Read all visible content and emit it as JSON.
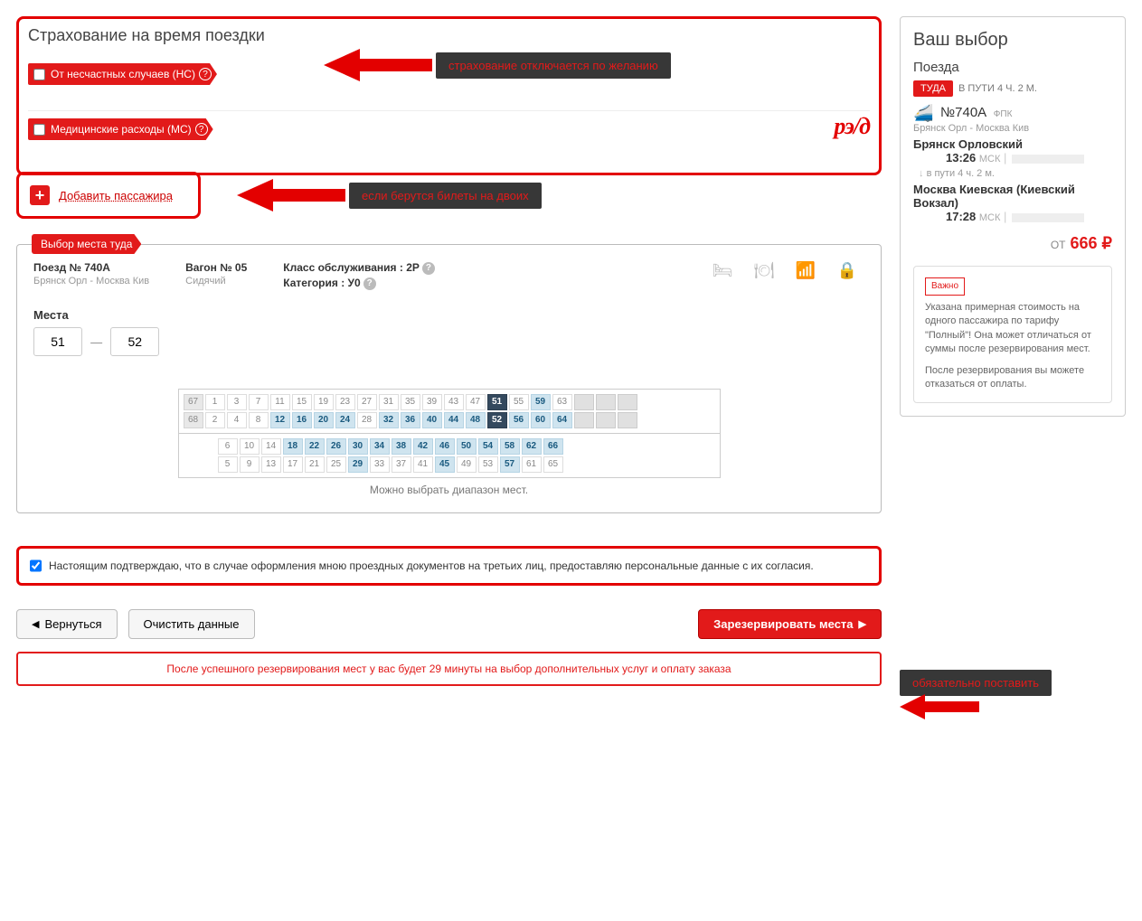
{
  "insurance": {
    "title": "Страхование на время поездки",
    "opt1": "От несчастных случаев (НС)",
    "opt2": "Медицинские расходы (МС)"
  },
  "annot": {
    "a1": "страхование отключается по желанию",
    "a2": "если берутся билеты на двоих",
    "a3": "обязательно поставить"
  },
  "addPassenger": "Добавить пассажира",
  "seatTab": "Выбор места туда",
  "trainCol": {
    "hdr": "Поезд № 740А",
    "sub": "Брянск Орл - Москва Кив"
  },
  "carCol": {
    "hdr": "Вагон № 05",
    "sub": "Сидячий"
  },
  "clsCol": {
    "l1": "Класс обслуживания : 2Р",
    "l2": "Категория : У0"
  },
  "seats": {
    "label": "Места",
    "from": "51",
    "to": "52",
    "note": "Можно выбрать диапазон мест.",
    "topRow1": [
      {
        "n": "67",
        "c": "left"
      },
      {
        "n": "1"
      },
      {
        "n": "3"
      },
      {
        "n": "7"
      },
      {
        "n": "11"
      },
      {
        "n": "15"
      },
      {
        "n": "19"
      },
      {
        "n": "23"
      },
      {
        "n": "27"
      },
      {
        "n": "31"
      },
      {
        "n": "35"
      },
      {
        "n": "39"
      },
      {
        "n": "43"
      },
      {
        "n": "47"
      },
      {
        "n": "51",
        "c": "sel"
      },
      {
        "n": "55"
      },
      {
        "n": "59",
        "c": "avail"
      },
      {
        "n": "63"
      },
      {
        "n": "",
        "c": "blank"
      },
      {
        "n": "",
        "c": "blank"
      },
      {
        "n": "",
        "c": "blank"
      }
    ],
    "topRow2": [
      {
        "n": "68",
        "c": "left"
      },
      {
        "n": "2"
      },
      {
        "n": "4"
      },
      {
        "n": "8"
      },
      {
        "n": "12",
        "c": "avail"
      },
      {
        "n": "16",
        "c": "avail"
      },
      {
        "n": "20",
        "c": "avail"
      },
      {
        "n": "24",
        "c": "avail"
      },
      {
        "n": "28"
      },
      {
        "n": "32",
        "c": "avail"
      },
      {
        "n": "36",
        "c": "avail"
      },
      {
        "n": "40",
        "c": "avail"
      },
      {
        "n": "44",
        "c": "avail"
      },
      {
        "n": "48",
        "c": "avail"
      },
      {
        "n": "52",
        "c": "sel"
      },
      {
        "n": "56",
        "c": "avail"
      },
      {
        "n": "60",
        "c": "avail"
      },
      {
        "n": "64",
        "c": "avail"
      },
      {
        "n": "",
        "c": "blank"
      },
      {
        "n": "",
        "c": "blank"
      },
      {
        "n": "",
        "c": "blank"
      }
    ],
    "botRow1": [
      {
        "n": "6"
      },
      {
        "n": "10"
      },
      {
        "n": "14"
      },
      {
        "n": "18",
        "c": "avail"
      },
      {
        "n": "22",
        "c": "avail"
      },
      {
        "n": "26",
        "c": "avail"
      },
      {
        "n": "30",
        "c": "avail"
      },
      {
        "n": "34",
        "c": "avail"
      },
      {
        "n": "38",
        "c": "avail"
      },
      {
        "n": "42",
        "c": "avail"
      },
      {
        "n": "46",
        "c": "avail"
      },
      {
        "n": "50",
        "c": "avail"
      },
      {
        "n": "54",
        "c": "avail"
      },
      {
        "n": "58",
        "c": "avail"
      },
      {
        "n": "62",
        "c": "avail"
      },
      {
        "n": "66",
        "c": "avail"
      }
    ],
    "botRow2": [
      {
        "n": "5"
      },
      {
        "n": "9"
      },
      {
        "n": "13"
      },
      {
        "n": "17"
      },
      {
        "n": "21"
      },
      {
        "n": "25"
      },
      {
        "n": "29",
        "c": "avail"
      },
      {
        "n": "33"
      },
      {
        "n": "37"
      },
      {
        "n": "41"
      },
      {
        "n": "45",
        "c": "avail"
      },
      {
        "n": "49"
      },
      {
        "n": "53"
      },
      {
        "n": "57",
        "c": "avail"
      },
      {
        "n": "61"
      },
      {
        "n": "65"
      }
    ]
  },
  "consent": "Настоящим подтверждаю, что в случае оформления мною проездных документов на третьих лиц, предоставляю персональные данные с их согласия.",
  "btn": {
    "back": "Вернуться",
    "clear": "Очистить данные",
    "reserve": "Зарезервировать места"
  },
  "infoBar": "После успешного резервирования мест у вас будет 29 минуты на выбор дополнительных услуг и оплату заказа",
  "side": {
    "title": "Ваш выбор",
    "sub": "Поезда",
    "dir": "Туда",
    "dur": "В ПУТИ 4 Ч. 2 М.",
    "trainNo": "№740А",
    "trainCo": "ФПК",
    "route": "Брянск Орл - Москва Кив",
    "st1": "Брянск Орловский",
    "t1": "13:26",
    "durLine": "в пути 4 ч. 2 м.",
    "st2": "Москва Киевская (Киевский Вокзал)",
    "t2": "17:28",
    "msk": "МСК",
    "ot": "ОТ",
    "price": "666 ₽",
    "noteTag": "Важно",
    "note1": "Указана примерная стоимость на одного пассажира по тарифу \"Полный\"! Она может отличаться от суммы после резервирования мест.",
    "note2": "После резервирования вы можете отказаться от оплаты."
  }
}
